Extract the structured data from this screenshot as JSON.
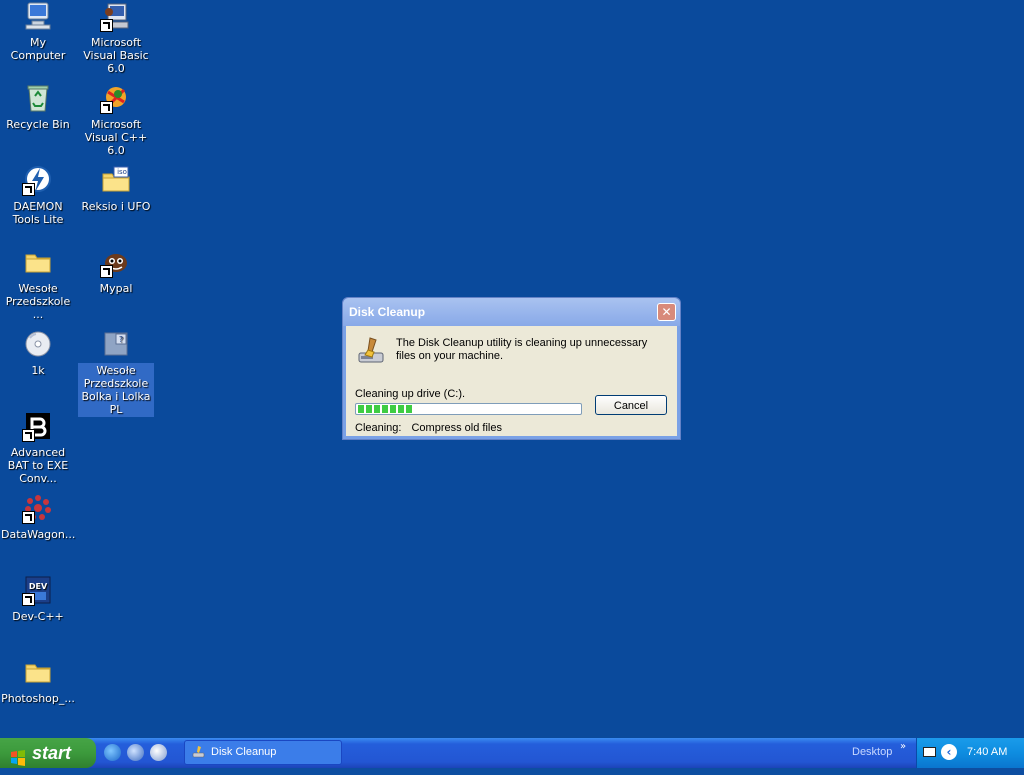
{
  "desktop": {
    "icons": [
      {
        "label": "My Computer"
      },
      {
        "label": "Microsoft Visual Basic 6.0"
      },
      {
        "label": "Recycle Bin"
      },
      {
        "label": "Microsoft Visual C++ 6.0"
      },
      {
        "label": "DAEMON Tools Lite"
      },
      {
        "label": "Reksio i UFO"
      },
      {
        "label": "Wesołe Przedszkole ..."
      },
      {
        "label": "Mypal"
      },
      {
        "label": "1k"
      },
      {
        "label": "Wesołe Przedszkole Bolka i Lolka PL"
      },
      {
        "label": "Advanced BAT to EXE Conv..."
      },
      {
        "label": "DataWagon..."
      },
      {
        "label": "Dev-C++"
      },
      {
        "label": "Photoshop_..."
      }
    ],
    "badge_text": "iso"
  },
  "dialog": {
    "title": "Disk Cleanup",
    "close_glyph": "✕",
    "message": "The Disk Cleanup utility is cleaning up unnecessary files on your machine.",
    "drive_text": "Cleaning up drive  (C:).",
    "progress_fraction": 0.25,
    "cancel_label": "Cancel",
    "cleaning_label": "Cleaning:",
    "cleaning_task": "Compress old files"
  },
  "taskbar": {
    "start_label": "start",
    "task_label": "Disk Cleanup",
    "desktop_label": "Desktop",
    "chevron": "»",
    "clock": "7:40 AM"
  },
  "colors": {
    "desktop_bg": "#0a4a9c",
    "dialog_frame": "#7aa1e6",
    "taskbar": "#245edb",
    "start_green": "#3c9a3c",
    "progress_green": "#3ecc43"
  }
}
